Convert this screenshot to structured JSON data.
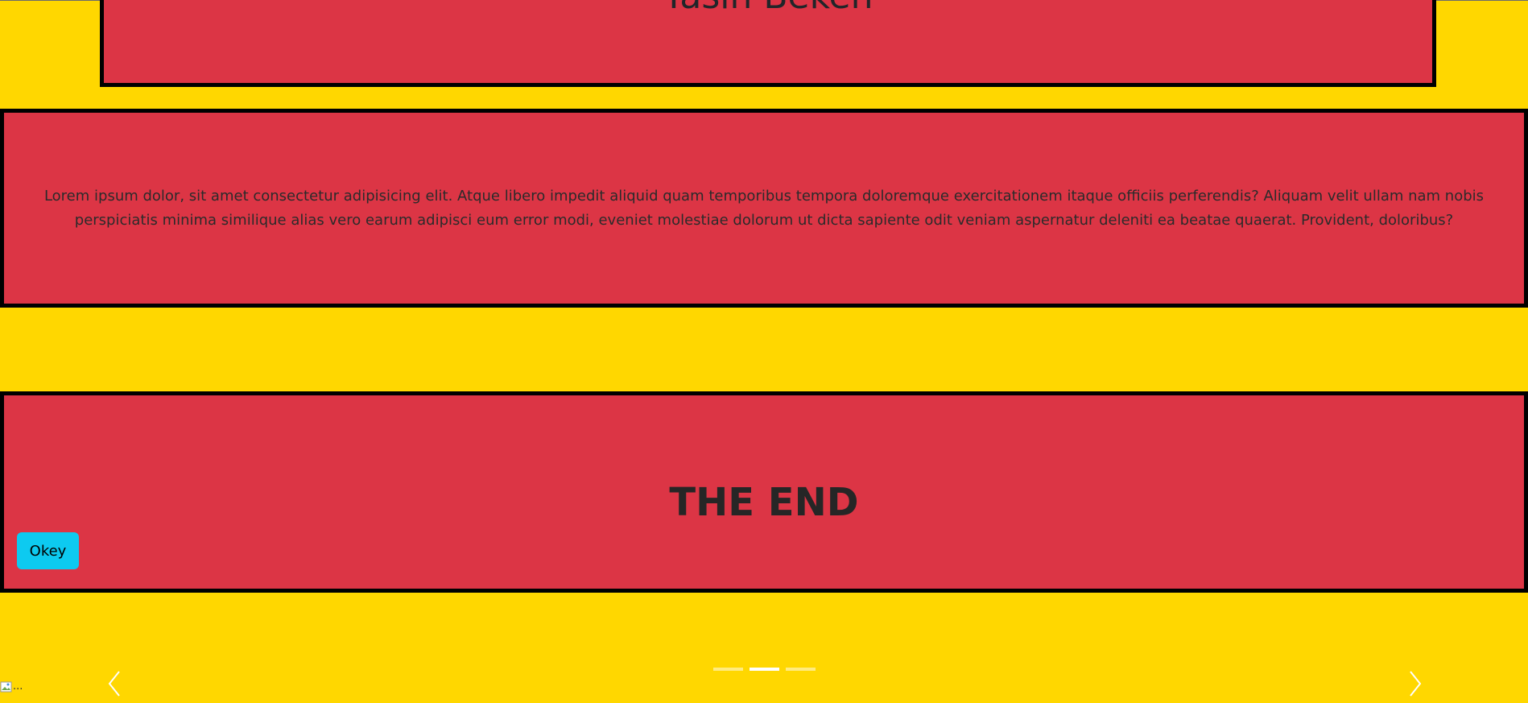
{
  "header_card": {
    "title": "Yasin Beken"
  },
  "text_card": {
    "paragraph": "Lorem ipsum dolor, sit amet consectetur adipisicing elit. Atque libero impedit aliquid quam temporibus tempora doloremque exercitationem itaque officiis perferendis? Aliquam velit ullam nam nobis perspiciatis minima similique alias vero earum adipisci eum error modi, eveniet molestiae dolorum ut dicta sapiente odit veniam aspernatur deleniti ea beatae quaerat. Provident, doloribus?"
  },
  "end_card": {
    "title": "THE END",
    "button_label": "Okey"
  },
  "carousel": {
    "indicators": [
      {
        "active": false
      },
      {
        "active": true
      },
      {
        "active": false
      }
    ],
    "prev_icon": "chevron-left-icon",
    "next_icon": "chevron-right-icon"
  },
  "broken_image": {
    "alt_text": "..."
  },
  "colors": {
    "page_background": "#ffd700",
    "card_background": "#dc3545",
    "card_border": "#000000",
    "button_background": "#0dcaf0",
    "indicator": "#ffffff"
  }
}
